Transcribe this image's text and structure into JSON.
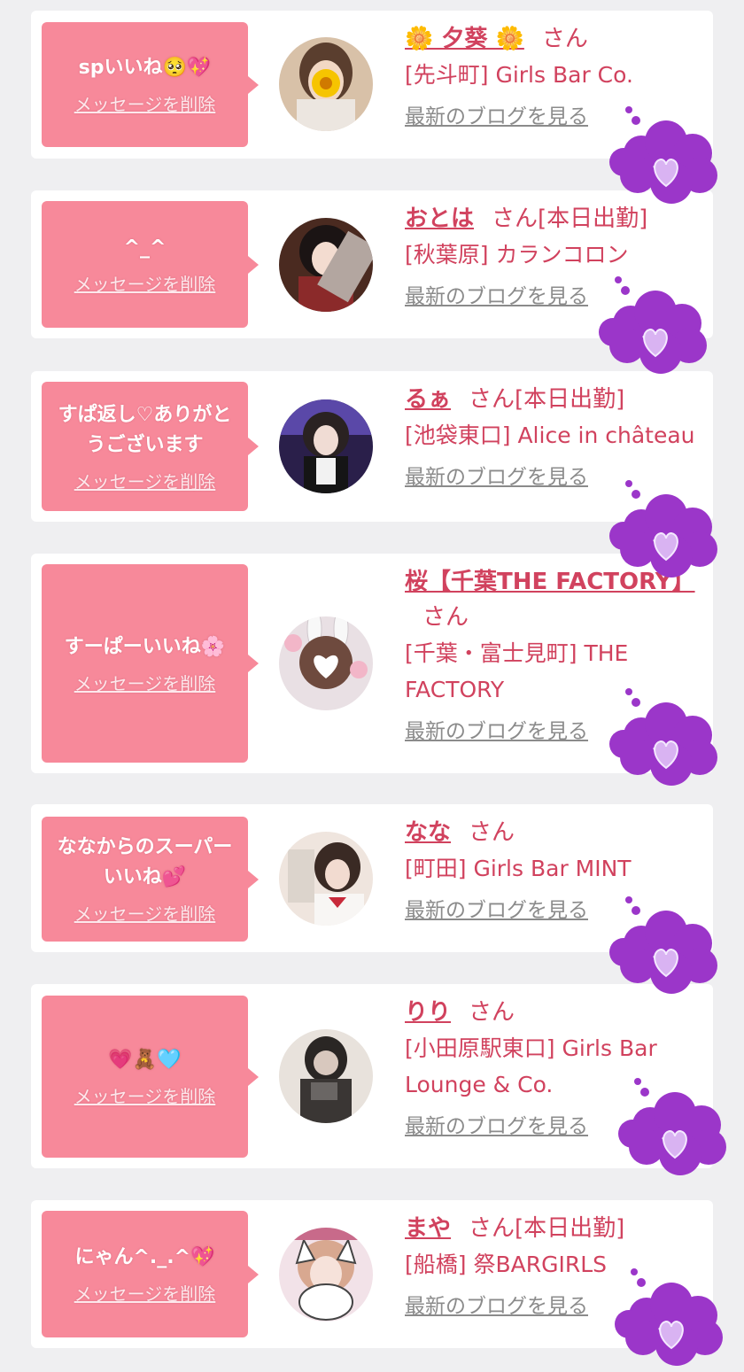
{
  "cards": [
    {
      "message": "spいいね🥺💖",
      "delete_label": "メッセージを削除",
      "name": "🌼 夕葵 🌼",
      "san": "さん",
      "status": "",
      "shop": "[先斗町] Girls Bar Co.",
      "blog_label": "最新のブログを見る",
      "avatar_icon": "avatar-photo",
      "reaction_icon": "purple-heart-cloud"
    },
    {
      "message": "^_^",
      "delete_label": "メッセージを削除",
      "name": "おとは",
      "san": "さん",
      "status": "[本日出勤]",
      "shop": "[秋葉原] カランコロン",
      "blog_label": "最新のブログを見る",
      "avatar_icon": "avatar-photo",
      "reaction_icon": "purple-heart-cloud"
    },
    {
      "message": "すぱ返し♡ありがとうございます",
      "delete_label": "メッセージを削除",
      "name": "るぁ",
      "san": "さん",
      "status": "[本日出勤]",
      "shop": "[池袋東口] Alice in château",
      "blog_label": "最新のブログを見る",
      "avatar_icon": "avatar-photo",
      "reaction_icon": "purple-heart-cloud"
    },
    {
      "message": "すーぱーいいね🌸",
      "delete_label": "メッセージを削除",
      "name": "桜【千葉THE FACTORY】",
      "san": "さん",
      "status": "",
      "shop": "[千葉・富士見町] THE FACTORY",
      "blog_label": "最新のブログを見る",
      "avatar_icon": "avatar-photo",
      "reaction_icon": "purple-heart-cloud"
    },
    {
      "message": "ななからのスーパーいいね💕",
      "delete_label": "メッセージを削除",
      "name": "なな",
      "san": "さん",
      "status": "",
      "shop": "[町田] Girls Bar MINT",
      "blog_label": "最新のブログを見る",
      "avatar_icon": "avatar-photo",
      "reaction_icon": "purple-heart-cloud"
    },
    {
      "message": "💗🧸🩵",
      "delete_label": "メッセージを削除",
      "name": "りり",
      "san": "さん",
      "status": "",
      "shop": "[小田原駅東口] Girls Bar Lounge & Co.",
      "blog_label": "最新のブログを見る",
      "avatar_icon": "avatar-photo",
      "reaction_icon": "purple-heart-cloud"
    },
    {
      "message": "にゃん^._.^💖",
      "delete_label": "メッセージを削除",
      "name": "まや",
      "san": "さん",
      "status": "[本日出勤]",
      "shop": "[船橋] 祭BARGIRLS",
      "blog_label": "最新のブログを見る",
      "avatar_icon": "avatar-photo",
      "reaction_icon": "purple-heart-cloud"
    }
  ],
  "colors": {
    "bubble": "#f7899a",
    "accent": "#d1425e",
    "cloud": "#9b36c9",
    "link_gray": "#8b8b8b"
  }
}
